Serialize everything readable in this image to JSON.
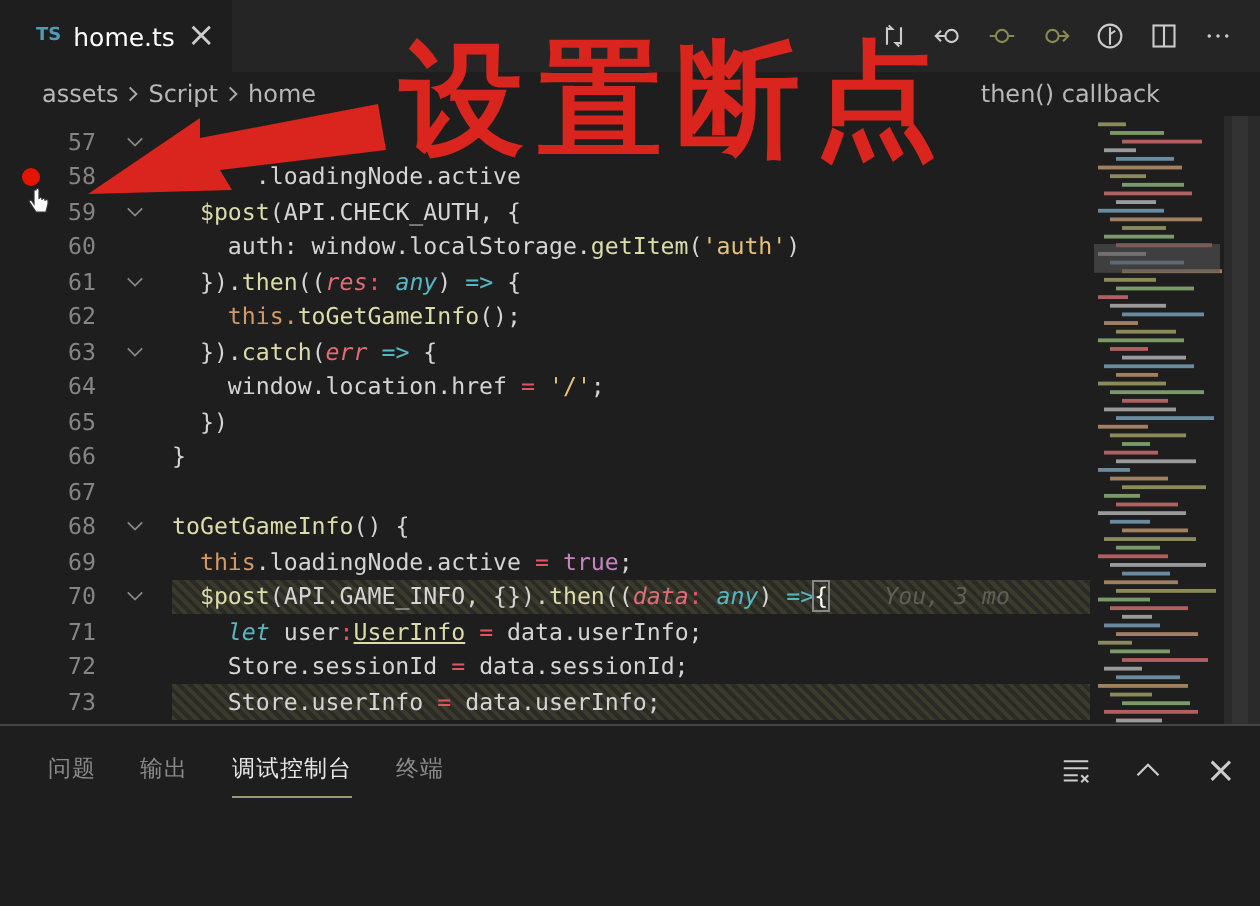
{
  "tab": {
    "badge": "TS",
    "title": "home.ts",
    "close": "×"
  },
  "breadcrumb": [
    "assets",
    "Script",
    "home",
    "then() callback"
  ],
  "annotation": {
    "text": "设置断点"
  },
  "lines": [
    {
      "number": "57",
      "foldable": true,
      "breakpoint": false,
      "highlighted": false
    },
    {
      "number": "58",
      "foldable": false,
      "breakpoint": true,
      "highlighted": false,
      "tokens": [
        {
          "text": "      .loadingNode.active",
          "kind": "plain"
        }
      ]
    },
    {
      "number": "59",
      "foldable": true,
      "breakpoint": false,
      "highlighted": false,
      "tokens": [
        {
          "text": "  $post",
          "kind": "fn"
        },
        {
          "text": "(API.CHECK_AUTH, {",
          "kind": "plain"
        }
      ]
    },
    {
      "number": "60",
      "foldable": false,
      "breakpoint": false,
      "highlighted": false,
      "tokens": [
        {
          "text": "    auth: window.localStorage.",
          "kind": "plain"
        },
        {
          "text": "getItem",
          "kind": "fn"
        },
        {
          "text": "(",
          "kind": "plain"
        },
        {
          "text": "'auth'",
          "kind": "str"
        },
        {
          "text": ")",
          "kind": "plain"
        }
      ]
    },
    {
      "number": "61",
      "foldable": true,
      "breakpoint": false,
      "highlighted": false,
      "tokens": [
        {
          "text": "  }).",
          "kind": "plain"
        },
        {
          "text": "then",
          "kind": "fn"
        },
        {
          "text": "((",
          "kind": "plain"
        },
        {
          "text": "res",
          "kind": "param"
        },
        {
          "text": ":",
          "kind": "op"
        },
        {
          "text": " any",
          "kind": "anytype"
        },
        {
          "text": ") ",
          "kind": "plain"
        },
        {
          "text": "=>",
          "kind": "arrow"
        },
        {
          "text": " {",
          "kind": "plain"
        }
      ]
    },
    {
      "number": "62",
      "foldable": false,
      "breakpoint": false,
      "highlighted": false,
      "tokens": [
        {
          "text": "    this.",
          "kind": "this"
        },
        {
          "text": "toGetGameInfo",
          "kind": "fn"
        },
        {
          "text": "();",
          "kind": "plain"
        }
      ]
    },
    {
      "number": "63",
      "foldable": true,
      "breakpoint": false,
      "highlighted": false,
      "tokens": [
        {
          "text": "  }).",
          "kind": "plain"
        },
        {
          "text": "catch",
          "kind": "fn"
        },
        {
          "text": "(",
          "kind": "plain"
        },
        {
          "text": "err",
          "kind": "param"
        },
        {
          "text": " =>",
          "kind": "arrow"
        },
        {
          "text": " {",
          "kind": "plain"
        }
      ]
    },
    {
      "number": "64",
      "foldable": false,
      "breakpoint": false,
      "highlighted": false,
      "tokens": [
        {
          "text": "    window.location.href",
          "kind": "plain"
        },
        {
          "text": " =",
          "kind": "op"
        },
        {
          "text": " '/'",
          "kind": "str"
        },
        {
          "text": ";",
          "kind": "plain"
        }
      ]
    },
    {
      "number": "65",
      "foldable": false,
      "breakpoint": false,
      "highlighted": false,
      "tokens": [
        {
          "text": "  })",
          "kind": "plain"
        }
      ]
    },
    {
      "number": "66",
      "foldable": false,
      "breakpoint": false,
      "highlighted": false,
      "tokens": [
        {
          "text": "}",
          "kind": "plain"
        }
      ]
    },
    {
      "number": "67",
      "foldable": false,
      "breakpoint": false,
      "highlighted": false
    },
    {
      "number": "68",
      "foldable": true,
      "breakpoint": false,
      "highlighted": false,
      "tokens": [
        {
          "text": "toGetGameInfo",
          "kind": "fn"
        },
        {
          "text": "() {",
          "kind": "plain"
        }
      ]
    },
    {
      "number": "69",
      "foldable": false,
      "breakpoint": false,
      "highlighted": false,
      "tokens": [
        {
          "text": "  this",
          "kind": "this"
        },
        {
          "text": ".loadingNode.active",
          "kind": "plain"
        },
        {
          "text": " =",
          "kind": "op"
        },
        {
          "text": " true",
          "kind": "bool"
        },
        {
          "text": ";",
          "kind": "plain"
        }
      ]
    },
    {
      "number": "70",
      "foldable": true,
      "breakpoint": false,
      "highlighted": true,
      "blame": "You, 3 mo",
      "tokens": [
        {
          "text": "  $post",
          "kind": "fn"
        },
        {
          "text": "(API.GAME_INFO, {}).",
          "kind": "plain"
        },
        {
          "text": "then",
          "kind": "fn"
        },
        {
          "text": "((",
          "kind": "plain"
        },
        {
          "text": "data",
          "kind": "param"
        },
        {
          "text": ":",
          "kind": "op"
        },
        {
          "text": " any",
          "kind": "anytype"
        },
        {
          "text": ") ",
          "kind": "plain"
        },
        {
          "text": "=>",
          "kind": "arrow"
        },
        {
          "text": "{",
          "kind": "bracket"
        }
      ]
    },
    {
      "number": "71",
      "foldable": false,
      "breakpoint": false,
      "highlighted": false,
      "tokens": [
        {
          "text": "    let",
          "kind": "keyword"
        },
        {
          "text": " user",
          "kind": "plain"
        },
        {
          "text": ":",
          "kind": "op"
        },
        {
          "text": "UserInfo",
          "kind": "type"
        },
        {
          "text": " =",
          "kind": "op"
        },
        {
          "text": " data.userInfo;",
          "kind": "plain"
        }
      ]
    },
    {
      "number": "72",
      "foldable": false,
      "breakpoint": false,
      "highlighted": false,
      "tokens": [
        {
          "text": "    Store.sessionId",
          "kind": "plain"
        },
        {
          "text": " =",
          "kind": "op"
        },
        {
          "text": " data.sessionId;",
          "kind": "plain"
        }
      ]
    },
    {
      "number": "73",
      "foldable": false,
      "breakpoint": false,
      "highlighted": true,
      "tokens": [
        {
          "text": "    Store.userInfo",
          "kind": "plain"
        },
        {
          "text": " =",
          "kind": "op"
        },
        {
          "text": " data.userInfo;",
          "kind": "plain"
        }
      ]
    }
  ],
  "panel": {
    "tabs": [
      {
        "label": "问题",
        "selected": false
      },
      {
        "label": "输出",
        "selected": false
      },
      {
        "label": "调试控制台",
        "selected": true
      },
      {
        "label": "终端",
        "selected": false
      }
    ],
    "close": "×"
  }
}
